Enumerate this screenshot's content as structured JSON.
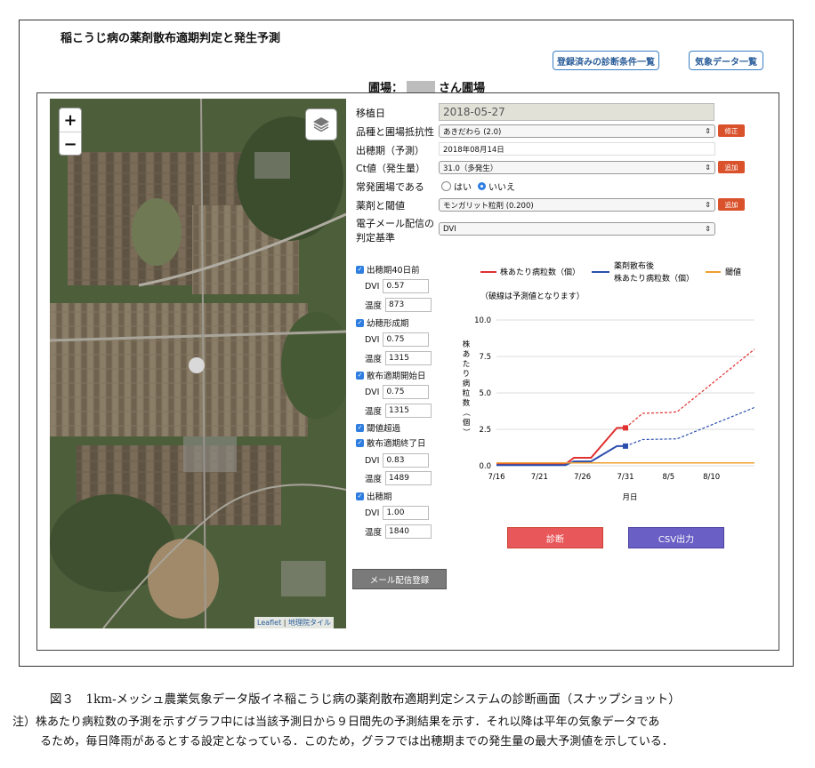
{
  "app_title": "稲こうじ病の薬剤散布適期判定と発生予測",
  "header_buttons": {
    "conditions": "登録済みの診断条件一覧",
    "weather": "気象データ一覧"
  },
  "field": {
    "prefix": "圃場：",
    "suffix": "さん圃場"
  },
  "map": {
    "zoom_in": "+",
    "zoom_out": "−",
    "attribution_leaflet": "Leaflet",
    "attribution_sep": " | ",
    "attribution_tiles": "地理院タイル"
  },
  "form": {
    "transplant_label": "移植日",
    "transplant_value": "2018-05-27",
    "variety_label": "品種と圃場抵抗性",
    "variety_value": "あきだわら (2.0)",
    "variety_btn": "修正",
    "heading_label": "出穂期（予測）",
    "heading_value": "2018年08月14日",
    "ct_label": "Ct値（発生量）",
    "ct_value": "31.0（多発生）",
    "ct_btn": "追加",
    "frequent_label": "常発圃場である",
    "frequent_yes": "はい",
    "frequent_no": "いいえ",
    "chemical_label": "薬剤と閾値",
    "chemical_value": "モンガリット粒剤 (0.200)",
    "chemical_btn": "追加",
    "email_label_1": "電子メール配信の",
    "email_label_2": "判定基準",
    "email_value": "DVI"
  },
  "stages": [
    {
      "label": "出穂期40日前",
      "dvi": "0.57",
      "temp": "873"
    },
    {
      "label": "幼穂形成期",
      "dvi": "0.75",
      "temp": "1315"
    },
    {
      "label": "散布適期開始日",
      "dvi": "0.75",
      "temp": "1315"
    },
    {
      "label": "閾値超過"
    },
    {
      "label": "散布適期終了日",
      "dvi": "0.83",
      "temp": "1489"
    },
    {
      "label": "出穂期",
      "dvi": "1.00",
      "temp": "1840"
    }
  ],
  "stage_keys": {
    "dvi": "DVI",
    "temp": "温度"
  },
  "mail_button": "メール配信登録",
  "legend": {
    "red": "株あたり病粒数（個）",
    "blue_1": "薬剤散布後",
    "blue_2": "株あたり病粒数（個）",
    "orange": "閾値",
    "note": "（破線は予測値となります）"
  },
  "buttons": {
    "diagnose": "診断",
    "csv": "CSV出力"
  },
  "colors": {
    "red": "#e03030",
    "blue": "#2c4fae",
    "orange": "#f0a030",
    "diag_btn": "#e8575a",
    "csv_btn": "#6a5fc4"
  },
  "chart_data": {
    "type": "line",
    "xlabel": "月日",
    "ylabel": "株あたり病粒数（個）",
    "x_ticks": [
      "7/16",
      "7/21",
      "7/26",
      "7/31",
      "8/5",
      "8/10"
    ],
    "y_ticks": [
      "0.0",
      "2.5",
      "5.0",
      "7.5",
      "10.0"
    ],
    "ylim": [
      0,
      10
    ],
    "xlim": [
      "7/16",
      "8/15"
    ],
    "series": [
      {
        "name": "株あたり病粒数（個）",
        "color": "red",
        "style": "solid",
        "points": [
          [
            "7/16",
            0.1
          ],
          [
            "7/24",
            0.1
          ],
          [
            "7/25",
            0.55
          ],
          [
            "7/27",
            0.55
          ],
          [
            "7/30",
            2.6
          ],
          [
            "7/31",
            2.6
          ]
        ]
      },
      {
        "name": "株あたり病粒数（個）",
        "color": "red",
        "style": "dashed",
        "points": [
          [
            "7/31",
            2.6
          ],
          [
            "8/2",
            3.6
          ],
          [
            "8/5",
            3.65
          ],
          [
            "8/6",
            3.7
          ],
          [
            "8/15",
            8.0
          ]
        ]
      },
      {
        "name": "薬剤散布後 株あたり病粒数（個）",
        "color": "blue",
        "style": "solid",
        "points": [
          [
            "7/16",
            0.05
          ],
          [
            "7/24",
            0.05
          ],
          [
            "7/25",
            0.3
          ],
          [
            "7/27",
            0.3
          ],
          [
            "7/30",
            1.35
          ],
          [
            "7/31",
            1.35
          ]
        ]
      },
      {
        "name": "薬剤散布後 株あたり病粒数（個）",
        "color": "blue",
        "style": "dashed",
        "points": [
          [
            "7/31",
            1.35
          ],
          [
            "8/2",
            1.8
          ],
          [
            "8/6",
            1.85
          ],
          [
            "8/15",
            4.0
          ]
        ]
      },
      {
        "name": "閾値",
        "color": "orange",
        "style": "solid",
        "points": [
          [
            "7/16",
            0.2
          ],
          [
            "8/15",
            0.2
          ]
        ]
      }
    ],
    "markers": [
      {
        "series": "red",
        "x": "7/31",
        "y": 2.6
      },
      {
        "series": "blue",
        "x": "7/31",
        "y": 1.35
      }
    ]
  },
  "caption": "図３　1km-メッシュ農業気象データ版イネ稲こうじ病の薬剤散布適期判定システムの診断画面（スナップショット）",
  "note_1": "注）株あたり病粒数の予測を示すグラフ中には当該予測日から９日間先の予測結果を示す．それ以降は平年の気象データであ",
  "note_2": "るため，毎日降雨があるとする設定となっている．このため，グラフでは出穂期までの発生量の最大予測値を示している．"
}
